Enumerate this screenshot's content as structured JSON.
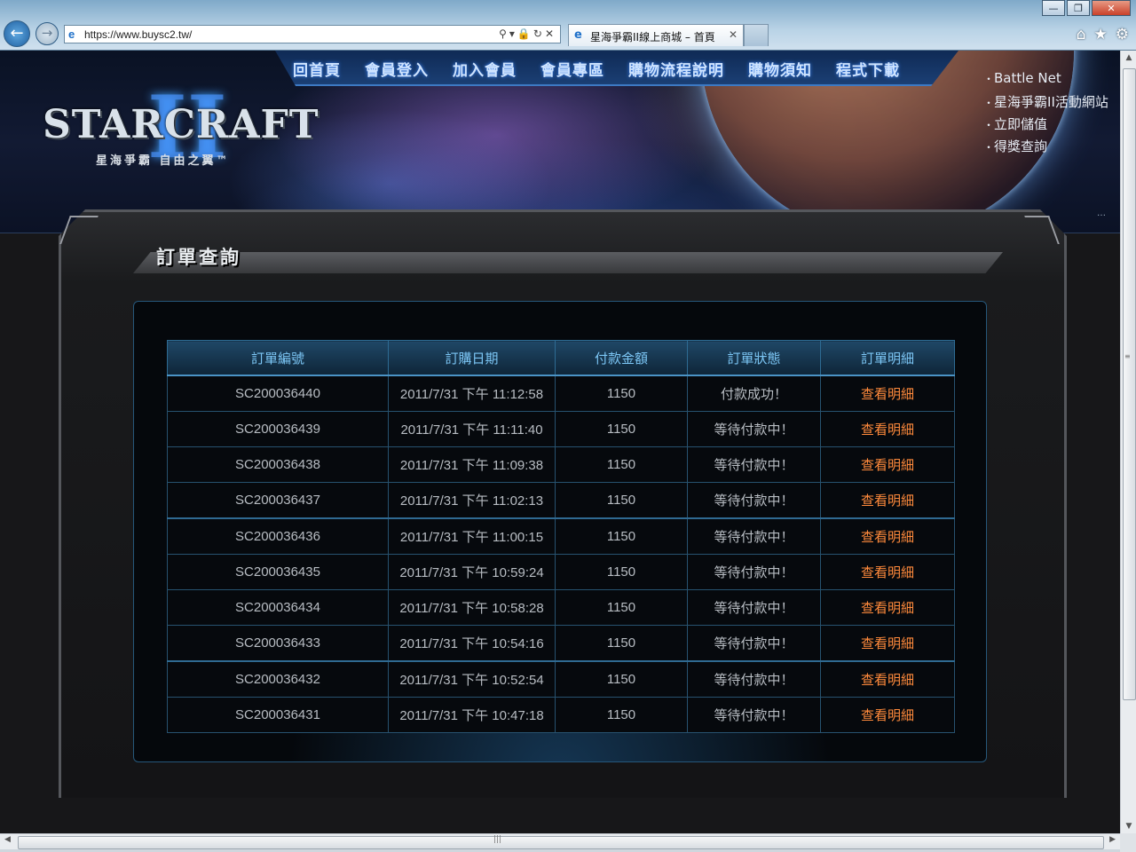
{
  "browser": {
    "address_url": "https://www.buysc2.tw/",
    "tab_title": "星海爭霸II線上商城 – 首頁",
    "tab_close": "✕",
    "minimize": "—",
    "maximize": "❐",
    "close": "✕"
  },
  "site": {
    "logo_text": "STARCRAFT",
    "logo_sub": "星海爭霸 自由之翼™",
    "nav": [
      "回首頁",
      "會員登入",
      "加入會員",
      "會員專區",
      "購物流程說明",
      "購物須知",
      "程式下載"
    ],
    "side_links": [
      "Battle Net",
      "星海爭霸II活動網站",
      "立即儲值",
      "得獎查詢"
    ],
    "banner_dots": "…"
  },
  "panel": {
    "title": "訂單查詢"
  },
  "orders": {
    "headers": [
      "訂單編號",
      "訂購日期",
      "付款金額",
      "訂單狀態",
      "訂單明細"
    ],
    "rows": [
      {
        "id": "SC200036440",
        "date": "2011/7/31 下午 11:12:58",
        "amount": "1150",
        "status": "付款成功！",
        "detail": "查看明細"
      },
      {
        "id": "SC200036439",
        "date": "2011/7/31 下午 11:11:40",
        "amount": "1150",
        "status": "等待付款中！",
        "detail": "查看明細"
      },
      {
        "id": "SC200036438",
        "date": "2011/7/31 下午 11:09:38",
        "amount": "1150",
        "status": "等待付款中！",
        "detail": "查看明細"
      },
      {
        "id": "SC200036437",
        "date": "2011/7/31 下午 11:02:13",
        "amount": "1150",
        "status": "等待付款中！",
        "detail": "查看明細"
      },
      {
        "id": "SC200036436",
        "date": "2011/7/31 下午 11:00:15",
        "amount": "1150",
        "status": "等待付款中！",
        "detail": "查看明細"
      },
      {
        "id": "SC200036435",
        "date": "2011/7/31 下午 10:59:24",
        "amount": "1150",
        "status": "等待付款中！",
        "detail": "查看明細"
      },
      {
        "id": "SC200036434",
        "date": "2011/7/31 下午 10:58:28",
        "amount": "1150",
        "status": "等待付款中！",
        "detail": "查看明細"
      },
      {
        "id": "SC200036433",
        "date": "2011/7/31 下午 10:54:16",
        "amount": "1150",
        "status": "等待付款中！",
        "detail": "查看明細"
      },
      {
        "id": "SC200036432",
        "date": "2011/7/31 下午 10:52:54",
        "amount": "1150",
        "status": "等待付款中！",
        "detail": "查看明細"
      },
      {
        "id": "SC200036431",
        "date": "2011/7/31 下午 10:47:18",
        "amount": "1150",
        "status": "等待付款中！",
        "detail": "查看明細"
      }
    ]
  },
  "colors": {
    "link_orange": "#ff8a3c",
    "header_blue": "#7cc6f5",
    "nav_glow": "#3a87ff"
  }
}
